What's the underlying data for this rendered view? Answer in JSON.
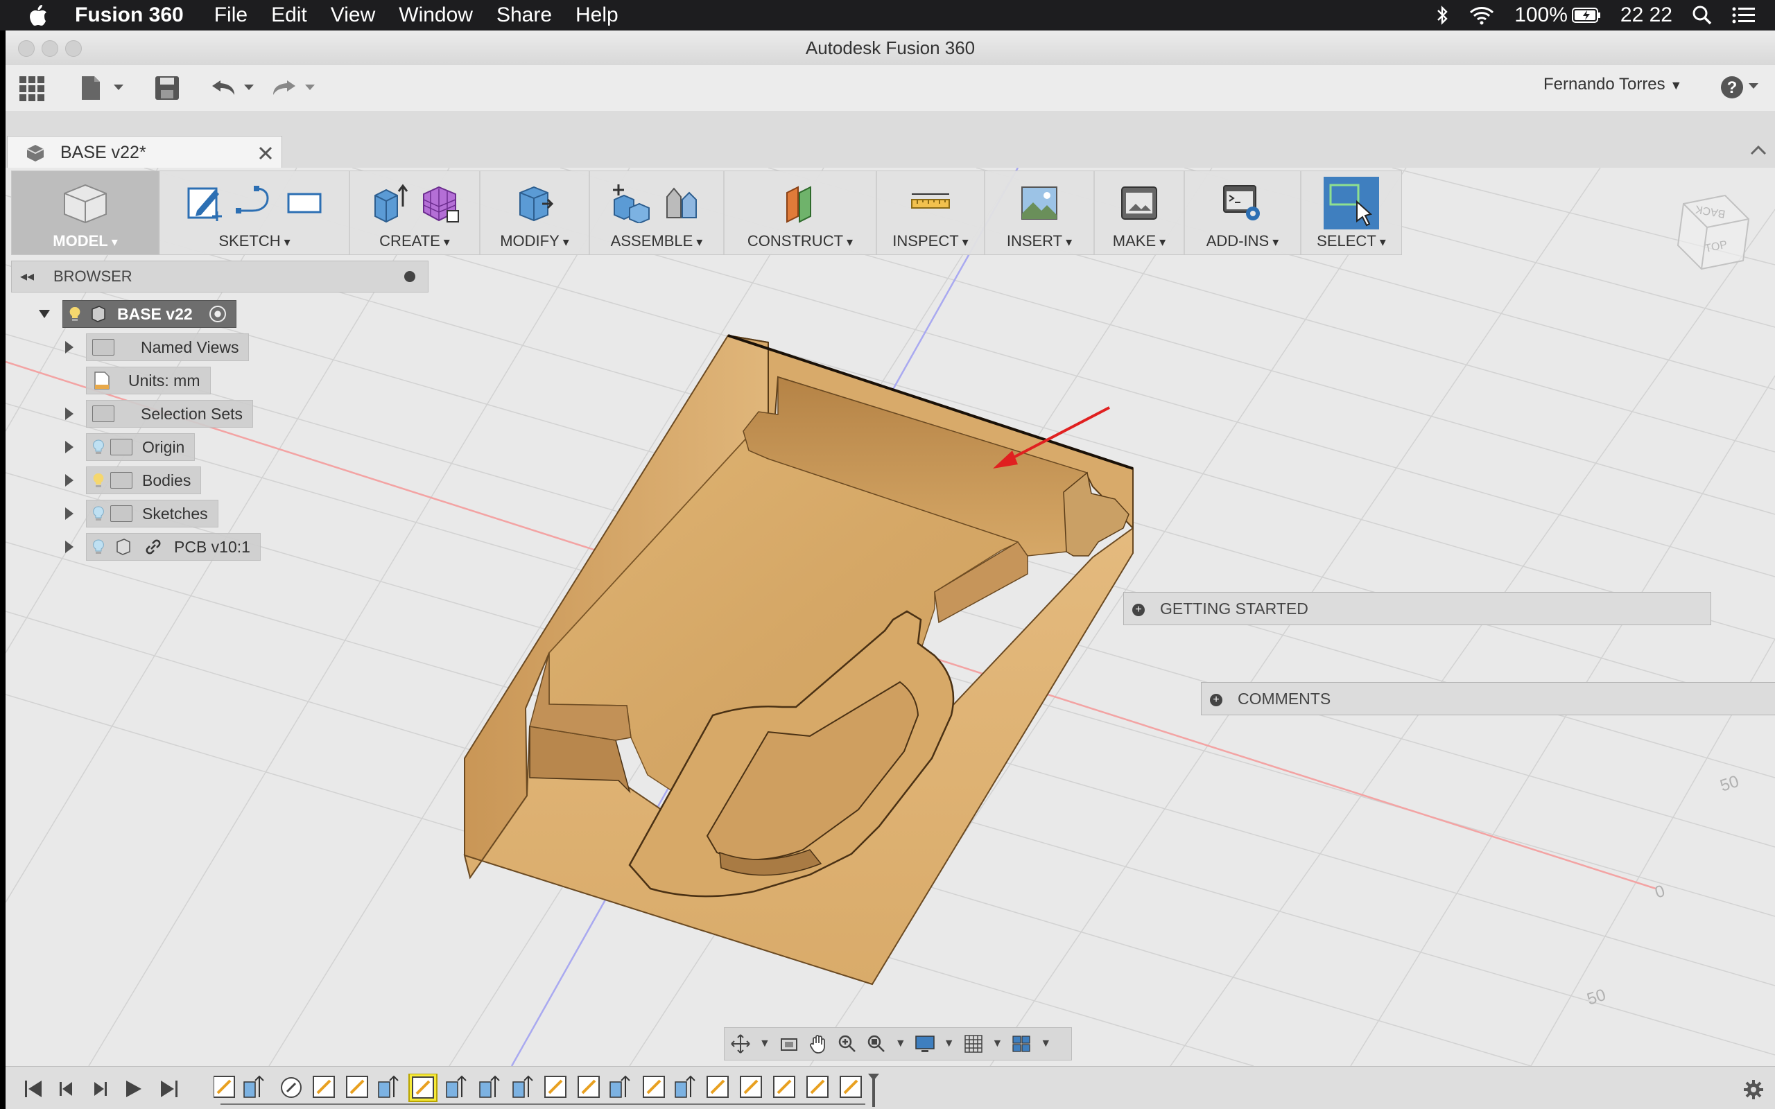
{
  "menubar": {
    "app_name": "Fusion 360",
    "items": [
      "File",
      "Edit",
      "View",
      "Window",
      "Share",
      "Help"
    ],
    "battery": "100%",
    "time": "22 22"
  },
  "window": {
    "title": "Autodesk Fusion 360"
  },
  "toolbar": {
    "user_name": "Fernando Torres"
  },
  "document": {
    "tab_title": "BASE v22*"
  },
  "ribbon": {
    "workspace": "MODEL",
    "groups": [
      "SKETCH",
      "CREATE",
      "MODIFY",
      "ASSEMBLE",
      "CONSTRUCT",
      "INSPECT",
      "INSERT",
      "MAKE",
      "ADD-INS",
      "SELECT"
    ]
  },
  "browser": {
    "title": "BROWSER",
    "root": "BASE v22",
    "items": [
      "Named Views",
      "Units: mm",
      "Selection Sets",
      "Origin",
      "Bodies",
      "Sketches",
      "PCB v10:1"
    ]
  },
  "panels": {
    "getting_started": "GETTING STARTED",
    "comments": "COMMENTS"
  },
  "viewcube": {
    "back": "BACK",
    "top": "TOP"
  },
  "grid_labels": [
    "50",
    "0",
    "50"
  ],
  "colors": {
    "wood_light": "#e2b878",
    "wood_mid": "#c9965a",
    "wood_dark": "#9c6b37",
    "select_blue": "#3f7fbf",
    "arrow_red": "#e02020"
  }
}
